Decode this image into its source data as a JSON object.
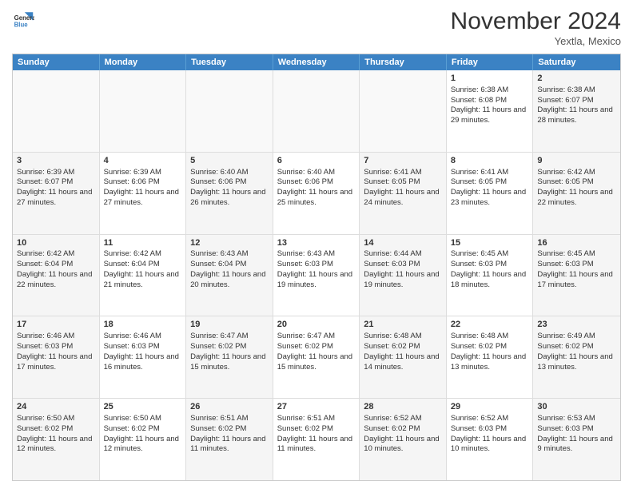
{
  "header": {
    "logo_general": "General",
    "logo_blue": "Blue",
    "month_title": "November 2024",
    "location": "Yextla, Mexico"
  },
  "weekdays": [
    "Sunday",
    "Monday",
    "Tuesday",
    "Wednesday",
    "Thursday",
    "Friday",
    "Saturday"
  ],
  "weeks": [
    [
      {
        "day": "",
        "empty": true
      },
      {
        "day": "",
        "empty": true
      },
      {
        "day": "",
        "empty": true
      },
      {
        "day": "",
        "empty": true
      },
      {
        "day": "",
        "empty": true
      },
      {
        "day": "1",
        "sunrise": "Sunrise: 6:38 AM",
        "sunset": "Sunset: 6:08 PM",
        "daylight": "Daylight: 11 hours and 29 minutes."
      },
      {
        "day": "2",
        "sunrise": "Sunrise: 6:38 AM",
        "sunset": "Sunset: 6:07 PM",
        "daylight": "Daylight: 11 hours and 28 minutes."
      }
    ],
    [
      {
        "day": "3",
        "sunrise": "Sunrise: 6:39 AM",
        "sunset": "Sunset: 6:07 PM",
        "daylight": "Daylight: 11 hours and 27 minutes."
      },
      {
        "day": "4",
        "sunrise": "Sunrise: 6:39 AM",
        "sunset": "Sunset: 6:06 PM",
        "daylight": "Daylight: 11 hours and 27 minutes."
      },
      {
        "day": "5",
        "sunrise": "Sunrise: 6:40 AM",
        "sunset": "Sunset: 6:06 PM",
        "daylight": "Daylight: 11 hours and 26 minutes."
      },
      {
        "day": "6",
        "sunrise": "Sunrise: 6:40 AM",
        "sunset": "Sunset: 6:06 PM",
        "daylight": "Daylight: 11 hours and 25 minutes."
      },
      {
        "day": "7",
        "sunrise": "Sunrise: 6:41 AM",
        "sunset": "Sunset: 6:05 PM",
        "daylight": "Daylight: 11 hours and 24 minutes."
      },
      {
        "day": "8",
        "sunrise": "Sunrise: 6:41 AM",
        "sunset": "Sunset: 6:05 PM",
        "daylight": "Daylight: 11 hours and 23 minutes."
      },
      {
        "day": "9",
        "sunrise": "Sunrise: 6:42 AM",
        "sunset": "Sunset: 6:05 PM",
        "daylight": "Daylight: 11 hours and 22 minutes."
      }
    ],
    [
      {
        "day": "10",
        "sunrise": "Sunrise: 6:42 AM",
        "sunset": "Sunset: 6:04 PM",
        "daylight": "Daylight: 11 hours and 22 minutes."
      },
      {
        "day": "11",
        "sunrise": "Sunrise: 6:42 AM",
        "sunset": "Sunset: 6:04 PM",
        "daylight": "Daylight: 11 hours and 21 minutes."
      },
      {
        "day": "12",
        "sunrise": "Sunrise: 6:43 AM",
        "sunset": "Sunset: 6:04 PM",
        "daylight": "Daylight: 11 hours and 20 minutes."
      },
      {
        "day": "13",
        "sunrise": "Sunrise: 6:43 AM",
        "sunset": "Sunset: 6:03 PM",
        "daylight": "Daylight: 11 hours and 19 minutes."
      },
      {
        "day": "14",
        "sunrise": "Sunrise: 6:44 AM",
        "sunset": "Sunset: 6:03 PM",
        "daylight": "Daylight: 11 hours and 19 minutes."
      },
      {
        "day": "15",
        "sunrise": "Sunrise: 6:45 AM",
        "sunset": "Sunset: 6:03 PM",
        "daylight": "Daylight: 11 hours and 18 minutes."
      },
      {
        "day": "16",
        "sunrise": "Sunrise: 6:45 AM",
        "sunset": "Sunset: 6:03 PM",
        "daylight": "Daylight: 11 hours and 17 minutes."
      }
    ],
    [
      {
        "day": "17",
        "sunrise": "Sunrise: 6:46 AM",
        "sunset": "Sunset: 6:03 PM",
        "daylight": "Daylight: 11 hours and 17 minutes."
      },
      {
        "day": "18",
        "sunrise": "Sunrise: 6:46 AM",
        "sunset": "Sunset: 6:03 PM",
        "daylight": "Daylight: 11 hours and 16 minutes."
      },
      {
        "day": "19",
        "sunrise": "Sunrise: 6:47 AM",
        "sunset": "Sunset: 6:02 PM",
        "daylight": "Daylight: 11 hours and 15 minutes."
      },
      {
        "day": "20",
        "sunrise": "Sunrise: 6:47 AM",
        "sunset": "Sunset: 6:02 PM",
        "daylight": "Daylight: 11 hours and 15 minutes."
      },
      {
        "day": "21",
        "sunrise": "Sunrise: 6:48 AM",
        "sunset": "Sunset: 6:02 PM",
        "daylight": "Daylight: 11 hours and 14 minutes."
      },
      {
        "day": "22",
        "sunrise": "Sunrise: 6:48 AM",
        "sunset": "Sunset: 6:02 PM",
        "daylight": "Daylight: 11 hours and 13 minutes."
      },
      {
        "day": "23",
        "sunrise": "Sunrise: 6:49 AM",
        "sunset": "Sunset: 6:02 PM",
        "daylight": "Daylight: 11 hours and 13 minutes."
      }
    ],
    [
      {
        "day": "24",
        "sunrise": "Sunrise: 6:50 AM",
        "sunset": "Sunset: 6:02 PM",
        "daylight": "Daylight: 11 hours and 12 minutes."
      },
      {
        "day": "25",
        "sunrise": "Sunrise: 6:50 AM",
        "sunset": "Sunset: 6:02 PM",
        "daylight": "Daylight: 11 hours and 12 minutes."
      },
      {
        "day": "26",
        "sunrise": "Sunrise: 6:51 AM",
        "sunset": "Sunset: 6:02 PM",
        "daylight": "Daylight: 11 hours and 11 minutes."
      },
      {
        "day": "27",
        "sunrise": "Sunrise: 6:51 AM",
        "sunset": "Sunset: 6:02 PM",
        "daylight": "Daylight: 11 hours and 11 minutes."
      },
      {
        "day": "28",
        "sunrise": "Sunrise: 6:52 AM",
        "sunset": "Sunset: 6:02 PM",
        "daylight": "Daylight: 11 hours and 10 minutes."
      },
      {
        "day": "29",
        "sunrise": "Sunrise: 6:52 AM",
        "sunset": "Sunset: 6:03 PM",
        "daylight": "Daylight: 11 hours and 10 minutes."
      },
      {
        "day": "30",
        "sunrise": "Sunrise: 6:53 AM",
        "sunset": "Sunset: 6:03 PM",
        "daylight": "Daylight: 11 hours and 9 minutes."
      }
    ]
  ]
}
